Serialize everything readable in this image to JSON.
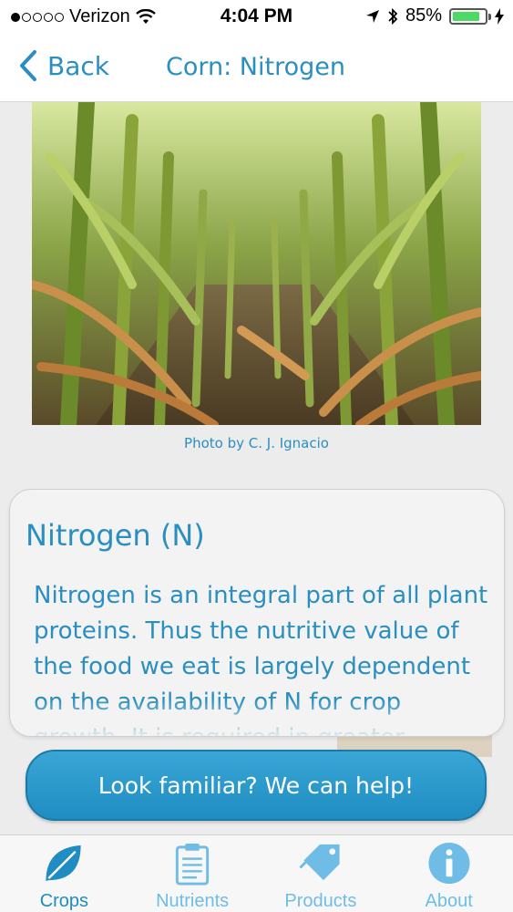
{
  "status_bar": {
    "carrier": "Verizon",
    "time": "4:04 PM",
    "battery_percent": "85%",
    "battery_level": 0.85,
    "battery_color": "#4cd964"
  },
  "nav": {
    "back_label": "Back",
    "title": "Corn: Nitrogen"
  },
  "photo": {
    "credit": "Photo by C. J. Ignacio"
  },
  "card": {
    "title": "Nitrogen (N)",
    "body": "Nitrogen is an integral part of all plant proteins. Thus the nutritive value of the food we eat is largely dependent on the availability of N for crop growth. It is required in greater"
  },
  "cta": {
    "label": "Look familiar? We can help!"
  },
  "tabs": [
    {
      "label": "Crops",
      "icon": "leaf-icon",
      "active": true
    },
    {
      "label": "Nutrients",
      "icon": "clipboard-icon",
      "active": false
    },
    {
      "label": "Products",
      "icon": "tag-icon",
      "active": false
    },
    {
      "label": "About",
      "icon": "info-icon",
      "active": false
    }
  ],
  "colors": {
    "accent": "#2a8fc0",
    "accent_light": "#6fbde6"
  }
}
